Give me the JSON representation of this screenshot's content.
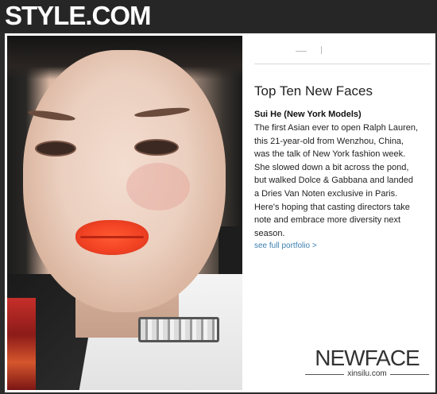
{
  "site": {
    "logo": "STYLE.COM"
  },
  "article": {
    "heading": "Top Ten New Faces",
    "name": "Sui He (New York Models)",
    "body_lines": [
      "The first Asian ever to open Ralph Lauren,",
      "this 21-year-old from Wenzhou, China,",
      "was the talk of New York fashion week.",
      "She slowed down a bit across the pond,",
      "but walked Dolce & Gabbana and landed",
      "a Dries Van Noten exclusive in Paris.",
      "Here's hoping that casting directors take",
      "note and embrace more diversity next",
      "season."
    ],
    "link": "see full portfolio >"
  },
  "watermark": {
    "title": "NEWFACE",
    "subtitle": "xinsilu.com"
  },
  "colors": {
    "topbar": "#262626",
    "link": "#3c7fb0",
    "lips": "#f24324"
  }
}
